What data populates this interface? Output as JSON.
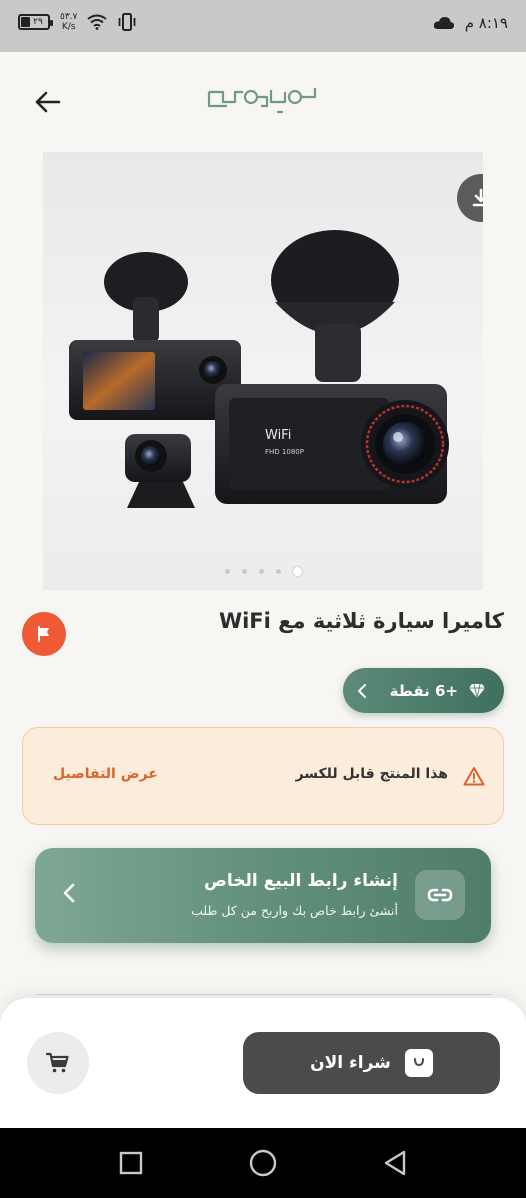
{
  "status_bar": {
    "battery": "٢٩",
    "net_speed_value": "٥٣.٧",
    "net_speed_unit": "K/s",
    "time": "٨:١٩ م"
  },
  "header": {
    "logo_text": "موجود",
    "back_icon": "arrow-left-icon"
  },
  "product": {
    "title": "كاميرا سيارة ثلاثية مع WiFi",
    "image_pages": 5,
    "image_active_index": 4,
    "image_text": {
      "wifi_label": "WiFi",
      "resolution_label": "FHD 1080P"
    }
  },
  "points": {
    "label": "+6 نقطة"
  },
  "warning": {
    "text": "هذا المنتج قابل للكسر",
    "details_link": "عرض التفاصيل"
  },
  "affiliate": {
    "title": "إنشاء رابط البيع الخاص",
    "subtitle": "أنشئ رابط خاص بك واربح من كل طلب"
  },
  "bottom_bar": {
    "buy_label": "شراء الان"
  },
  "colors": {
    "accent_green": "#5f8e7a",
    "report_red": "#ef5a36",
    "warning_bg": "#fbecdc",
    "warning_link": "#d9642e",
    "buy_button": "#4b4b4d"
  }
}
